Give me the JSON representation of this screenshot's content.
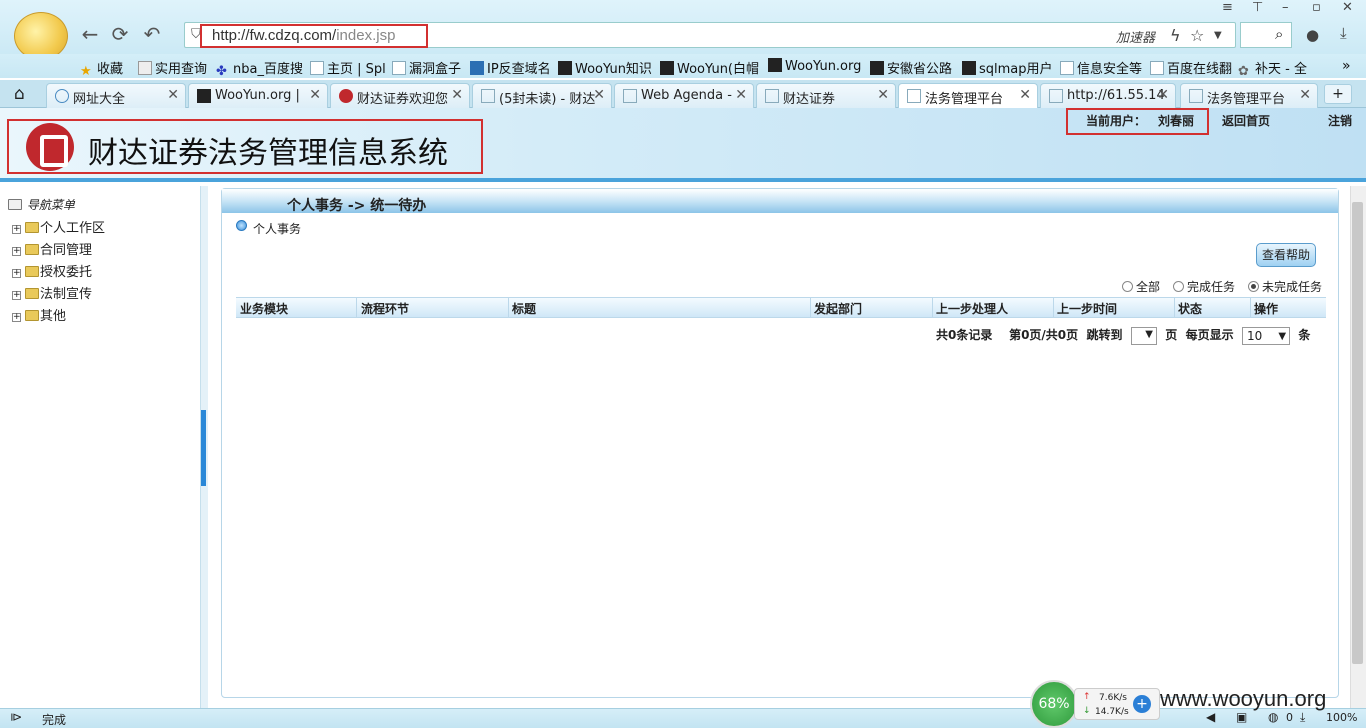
{
  "browser": {
    "url_host": "http://fw.cdzq.com/",
    "url_path": "index.jsp",
    "accelerator_label": "加速器",
    "bookmarks": [
      {
        "label": "收藏",
        "icon": "star-icon"
      },
      {
        "label": "实用查询",
        "icon": "folder-icon"
      },
      {
        "label": "nba_百度搜",
        "icon": "paw-icon"
      },
      {
        "label": "主页 | Spl",
        "icon": "page-icon"
      },
      {
        "label": "漏洞盒子",
        "icon": "page-icon"
      },
      {
        "label": "IP反查域名",
        "icon": "ip-icon"
      },
      {
        "label": "WooYun知识",
        "icon": "wooyun-icon"
      },
      {
        "label": "WooYun(白帽",
        "icon": "wooyun-icon"
      },
      {
        "label": "WooYun.org",
        "icon": "wooyun-icon"
      },
      {
        "label": "安徽省公路",
        "icon": "wooyun-icon"
      },
      {
        "label": "sqlmap用户",
        "icon": "wooyun-icon"
      },
      {
        "label": "信息安全等",
        "icon": "page-icon"
      },
      {
        "label": "百度在线翻",
        "icon": "page-icon"
      },
      {
        "label": "补天 - 全",
        "icon": "gear-icon"
      }
    ],
    "tabs": [
      {
        "label": "网址大全",
        "icon": "globe-icon"
      },
      {
        "label": "WooYun.org |",
        "icon": "wooyun-icon"
      },
      {
        "label": "财达证券欢迎您",
        "icon": "caida-icon"
      },
      {
        "label": "(5封未读) - 财达",
        "icon": "page-icon"
      },
      {
        "label": "Web Agenda -",
        "icon": "page-icon"
      },
      {
        "label": "财达证券",
        "icon": "page-icon"
      },
      {
        "label": "法务管理平台",
        "icon": "page-icon"
      },
      {
        "label": "http://61.55.14",
        "icon": "page-icon"
      },
      {
        "label": "法务管理平台",
        "icon": "page-icon"
      }
    ],
    "status_text": "完成",
    "speed_percent": "68%",
    "upload_speed": "7.6K/s",
    "download_speed": "14.7K/s",
    "watermark": "www.wooyun.org",
    "zoom_level": "100%",
    "download_count": "0"
  },
  "header": {
    "system_title": "财达证券法务管理信息系统",
    "current_user_label": "当前用户：",
    "current_user_name": "刘春丽",
    "home_link": "返回首页",
    "logout_link": "注销"
  },
  "nav": {
    "root_label": "导航菜单",
    "items": [
      {
        "label": "个人工作区"
      },
      {
        "label": "合同管理"
      },
      {
        "label": "授权委托"
      },
      {
        "label": "法制宣传"
      },
      {
        "label": "其他"
      }
    ]
  },
  "main": {
    "breadcrumb": "个人事务 -> 统一待办",
    "section_title": "个人事务",
    "help_button": "查看帮助",
    "filters": [
      {
        "label": "全部",
        "checked": false
      },
      {
        "label": "完成任务",
        "checked": false
      },
      {
        "label": "未完成任务",
        "checked": true
      }
    ],
    "columns": [
      "业务模块",
      "流程环节",
      "标题",
      "发起部门",
      "上一步处理人",
      "上一步时间",
      "状态",
      "操作"
    ],
    "pager": {
      "record_count": "共0条记录",
      "page_info": "第0页/共0页",
      "jump_label": "跳转到",
      "page_unit": "页",
      "per_page_label": "每页显示",
      "per_page_value": "10",
      "per_page_unit": "条"
    }
  }
}
